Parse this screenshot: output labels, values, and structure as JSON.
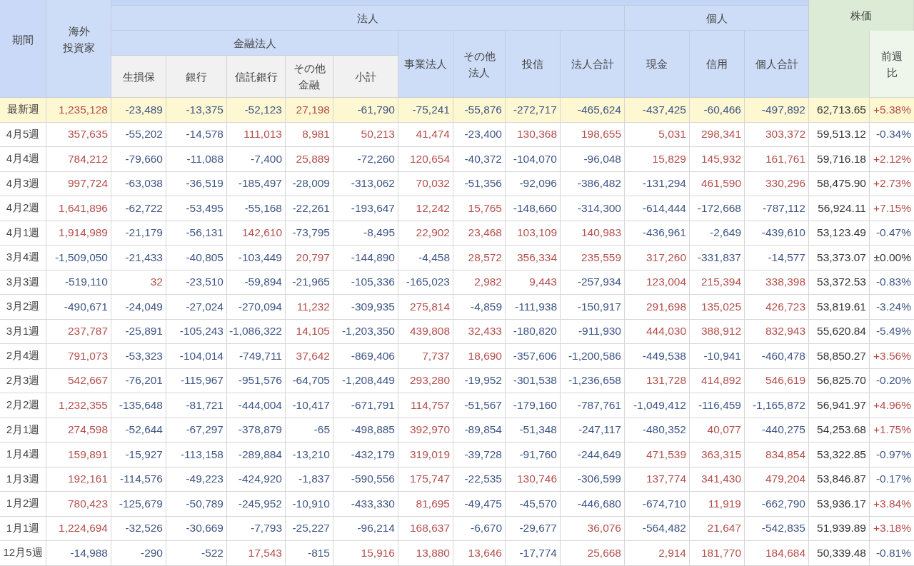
{
  "table": {
    "header": {
      "period": "期間",
      "foreign": "海外投資家",
      "corporate": "法人",
      "financial": "金融法人",
      "financial_columns": [
        "生損保",
        "銀行",
        "信託銀行",
        "その他金融",
        "小計"
      ],
      "corporate_columns": [
        "事業法人",
        "その他法人",
        "投信",
        "法人合計"
      ],
      "individual": "個人",
      "individual_columns": [
        "現金",
        "信用",
        "個人合計"
      ],
      "nikkei": "株価",
      "change": "前週比"
    },
    "rows": [
      {
        "period": "最新週",
        "highlighted": true,
        "flows": [
          {
            "text": "1,235,128",
            "color": "#b4504c"
          },
          {
            "text": "-23,489",
            "color": "#3f5786"
          },
          {
            "text": "-13,375",
            "color": "#3f5786"
          },
          {
            "text": "-52,123",
            "color": "#3f5786"
          },
          {
            "text": "27,198",
            "color": "#b4504c"
          },
          {
            "text": "-61,790",
            "color": "#3f5786"
          },
          {
            "text": "-75,241",
            "color": "#3f5786"
          },
          {
            "text": "-55,876",
            "color": "#3f5786"
          },
          {
            "text": "-272,717",
            "color": "#3f5786"
          },
          {
            "text": "-465,624",
            "color": "#3f5786"
          },
          {
            "text": "-437,425",
            "color": "#3f5786"
          },
          {
            "text": "-60,466",
            "color": "#3f5786"
          },
          {
            "text": "-497,892",
            "color": "#3f5786"
          }
        ],
        "nikkei": "62,713.65",
        "change": {
          "text": "+5.38%",
          "color": "#b4504c"
        }
      },
      {
        "period": "4月5週",
        "highlighted": false,
        "flows": [
          {
            "text": "357,635",
            "color": "#b4504c"
          },
          {
            "text": "-55,202",
            "color": "#3f5786"
          },
          {
            "text": "-14,578",
            "color": "#3f5786"
          },
          {
            "text": "111,013",
            "color": "#b4504c"
          },
          {
            "text": "8,981",
            "color": "#b4504c"
          },
          {
            "text": "50,213",
            "color": "#b4504c"
          },
          {
            "text": "41,474",
            "color": "#b4504c"
          },
          {
            "text": "-23,400",
            "color": "#3f5786"
          },
          {
            "text": "130,368",
            "color": "#b4504c"
          },
          {
            "text": "198,655",
            "color": "#b4504c"
          },
          {
            "text": "5,031",
            "color": "#b4504c"
          },
          {
            "text": "298,341",
            "color": "#b4504c"
          },
          {
            "text": "303,372",
            "color": "#b4504c"
          }
        ],
        "nikkei": "59,513.12",
        "change": {
          "text": "-0.34%",
          "color": "#3f5786"
        }
      },
      {
        "period": "4月4週",
        "highlighted": false,
        "flows": [
          {
            "text": "784,212",
            "color": "#b4504c"
          },
          {
            "text": "-79,660",
            "color": "#3f5786"
          },
          {
            "text": "-11,088",
            "color": "#3f5786"
          },
          {
            "text": "-7,400",
            "color": "#3f5786"
          },
          {
            "text": "25,889",
            "color": "#b4504c"
          },
          {
            "text": "-72,260",
            "color": "#3f5786"
          },
          {
            "text": "120,654",
            "color": "#b4504c"
          },
          {
            "text": "-40,372",
            "color": "#3f5786"
          },
          {
            "text": "-104,070",
            "color": "#3f5786"
          },
          {
            "text": "-96,048",
            "color": "#3f5786"
          },
          {
            "text": "15,829",
            "color": "#b4504c"
          },
          {
            "text": "145,932",
            "color": "#b4504c"
          },
          {
            "text": "161,761",
            "color": "#b4504c"
          }
        ],
        "nikkei": "59,716.18",
        "change": {
          "text": "+2.12%",
          "color": "#b4504c"
        }
      },
      {
        "period": "4月3週",
        "highlighted": false,
        "flows": [
          {
            "text": "997,724",
            "color": "#b4504c"
          },
          {
            "text": "-63,038",
            "color": "#3f5786"
          },
          {
            "text": "-36,519",
            "color": "#3f5786"
          },
          {
            "text": "-185,497",
            "color": "#3f5786"
          },
          {
            "text": "-28,009",
            "color": "#3f5786"
          },
          {
            "text": "-313,062",
            "color": "#3f5786"
          },
          {
            "text": "70,032",
            "color": "#b4504c"
          },
          {
            "text": "-51,356",
            "color": "#3f5786"
          },
          {
            "text": "-92,096",
            "color": "#3f5786"
          },
          {
            "text": "-386,482",
            "color": "#3f5786"
          },
          {
            "text": "-131,294",
            "color": "#3f5786"
          },
          {
            "text": "461,590",
            "color": "#b4504c"
          },
          {
            "text": "330,296",
            "color": "#b4504c"
          }
        ],
        "nikkei": "58,475.90",
        "change": {
          "text": "+2.73%",
          "color": "#b4504c"
        }
      },
      {
        "period": "4月2週",
        "highlighted": false,
        "flows": [
          {
            "text": "1,641,896",
            "color": "#b4504c"
          },
          {
            "text": "-62,722",
            "color": "#3f5786"
          },
          {
            "text": "-53,495",
            "color": "#3f5786"
          },
          {
            "text": "-55,168",
            "color": "#3f5786"
          },
          {
            "text": "-22,261",
            "color": "#3f5786"
          },
          {
            "text": "-193,647",
            "color": "#3f5786"
          },
          {
            "text": "12,242",
            "color": "#b4504c"
          },
          {
            "text": "15,765",
            "color": "#b4504c"
          },
          {
            "text": "-148,660",
            "color": "#3f5786"
          },
          {
            "text": "-314,300",
            "color": "#3f5786"
          },
          {
            "text": "-614,444",
            "color": "#3f5786"
          },
          {
            "text": "-172,668",
            "color": "#3f5786"
          },
          {
            "text": "-787,112",
            "color": "#3f5786"
          }
        ],
        "nikkei": "56,924.11",
        "change": {
          "text": "+7.15%",
          "color": "#b4504c"
        }
      },
      {
        "period": "4月1週",
        "highlighted": false,
        "flows": [
          {
            "text": "1,914,989",
            "color": "#b4504c"
          },
          {
            "text": "-21,179",
            "color": "#3f5786"
          },
          {
            "text": "-56,131",
            "color": "#3f5786"
          },
          {
            "text": "142,610",
            "color": "#b4504c"
          },
          {
            "text": "-73,795",
            "color": "#3f5786"
          },
          {
            "text": "-8,495",
            "color": "#3f5786"
          },
          {
            "text": "22,902",
            "color": "#b4504c"
          },
          {
            "text": "23,468",
            "color": "#b4504c"
          },
          {
            "text": "103,109",
            "color": "#b4504c"
          },
          {
            "text": "140,983",
            "color": "#b4504c"
          },
          {
            "text": "-436,961",
            "color": "#3f5786"
          },
          {
            "text": "-2,649",
            "color": "#3f5786"
          },
          {
            "text": "-439,610",
            "color": "#3f5786"
          }
        ],
        "nikkei": "53,123.49",
        "change": {
          "text": "-0.47%",
          "color": "#3f5786"
        }
      },
      {
        "period": "3月4週",
        "highlighted": false,
        "flows": [
          {
            "text": "-1,509,050",
            "color": "#3f5786"
          },
          {
            "text": "-21,433",
            "color": "#3f5786"
          },
          {
            "text": "-40,805",
            "color": "#3f5786"
          },
          {
            "text": "-103,449",
            "color": "#3f5786"
          },
          {
            "text": "20,797",
            "color": "#b4504c"
          },
          {
            "text": "-144,890",
            "color": "#3f5786"
          },
          {
            "text": "-4,458",
            "color": "#3f5786"
          },
          {
            "text": "28,572",
            "color": "#b4504c"
          },
          {
            "text": "356,334",
            "color": "#b4504c"
          },
          {
            "text": "235,559",
            "color": "#b4504c"
          },
          {
            "text": "317,260",
            "color": "#b4504c"
          },
          {
            "text": "-331,837",
            "color": "#3f5786"
          },
          {
            "text": "-14,577",
            "color": "#3f5786"
          }
        ],
        "nikkei": "53,373.07",
        "change": {
          "text": "±0.00%",
          "color": "#333333"
        }
      },
      {
        "period": "3月3週",
        "highlighted": false,
        "flows": [
          {
            "text": "-519,110",
            "color": "#3f5786"
          },
          {
            "text": "32",
            "color": "#b4504c"
          },
          {
            "text": "-23,510",
            "color": "#3f5786"
          },
          {
            "text": "-59,894",
            "color": "#3f5786"
          },
          {
            "text": "-21,965",
            "color": "#3f5786"
          },
          {
            "text": "-105,336",
            "color": "#3f5786"
          },
          {
            "text": "-165,023",
            "color": "#3f5786"
          },
          {
            "text": "2,982",
            "color": "#b4504c"
          },
          {
            "text": "9,443",
            "color": "#b4504c"
          },
          {
            "text": "-257,934",
            "color": "#3f5786"
          },
          {
            "text": "123,004",
            "color": "#b4504c"
          },
          {
            "text": "215,394",
            "color": "#b4504c"
          },
          {
            "text": "338,398",
            "color": "#b4504c"
          }
        ],
        "nikkei": "53,372.53",
        "change": {
          "text": "-0.83%",
          "color": "#3f5786"
        }
      },
      {
        "period": "3月2週",
        "highlighted": false,
        "flows": [
          {
            "text": "-490,671",
            "color": "#3f5786"
          },
          {
            "text": "-24,049",
            "color": "#3f5786"
          },
          {
            "text": "-27,024",
            "color": "#3f5786"
          },
          {
            "text": "-270,094",
            "color": "#3f5786"
          },
          {
            "text": "11,232",
            "color": "#b4504c"
          },
          {
            "text": "-309,935",
            "color": "#3f5786"
          },
          {
            "text": "275,814",
            "color": "#b4504c"
          },
          {
            "text": "-4,859",
            "color": "#3f5786"
          },
          {
            "text": "-111,938",
            "color": "#3f5786"
          },
          {
            "text": "-150,917",
            "color": "#3f5786"
          },
          {
            "text": "291,698",
            "color": "#b4504c"
          },
          {
            "text": "135,025",
            "color": "#b4504c"
          },
          {
            "text": "426,723",
            "color": "#b4504c"
          }
        ],
        "nikkei": "53,819.61",
        "change": {
          "text": "-3.24%",
          "color": "#3f5786"
        }
      },
      {
        "period": "3月1週",
        "highlighted": false,
        "flows": [
          {
            "text": "237,787",
            "color": "#b4504c"
          },
          {
            "text": "-25,891",
            "color": "#3f5786"
          },
          {
            "text": "-105,243",
            "color": "#3f5786"
          },
          {
            "text": "-1,086,322",
            "color": "#3f5786"
          },
          {
            "text": "14,105",
            "color": "#b4504c"
          },
          {
            "text": "-1,203,350",
            "color": "#3f5786"
          },
          {
            "text": "439,808",
            "color": "#b4504c"
          },
          {
            "text": "32,433",
            "color": "#b4504c"
          },
          {
            "text": "-180,820",
            "color": "#3f5786"
          },
          {
            "text": "-911,930",
            "color": "#3f5786"
          },
          {
            "text": "444,030",
            "color": "#b4504c"
          },
          {
            "text": "388,912",
            "color": "#b4504c"
          },
          {
            "text": "832,943",
            "color": "#b4504c"
          }
        ],
        "nikkei": "55,620.84",
        "change": {
          "text": "-5.49%",
          "color": "#3f5786"
        }
      },
      {
        "period": "2月4週",
        "highlighted": false,
        "flows": [
          {
            "text": "791,073",
            "color": "#b4504c"
          },
          {
            "text": "-53,323",
            "color": "#3f5786"
          },
          {
            "text": "-104,014",
            "color": "#3f5786"
          },
          {
            "text": "-749,711",
            "color": "#3f5786"
          },
          {
            "text": "37,642",
            "color": "#b4504c"
          },
          {
            "text": "-869,406",
            "color": "#3f5786"
          },
          {
            "text": "7,737",
            "color": "#b4504c"
          },
          {
            "text": "18,690",
            "color": "#b4504c"
          },
          {
            "text": "-357,606",
            "color": "#3f5786"
          },
          {
            "text": "-1,200,586",
            "color": "#3f5786"
          },
          {
            "text": "-449,538",
            "color": "#3f5786"
          },
          {
            "text": "-10,941",
            "color": "#3f5786"
          },
          {
            "text": "-460,478",
            "color": "#3f5786"
          }
        ],
        "nikkei": "58,850.27",
        "change": {
          "text": "+3.56%",
          "color": "#b4504c"
        }
      },
      {
        "period": "2月3週",
        "highlighted": false,
        "flows": [
          {
            "text": "542,667",
            "color": "#b4504c"
          },
          {
            "text": "-76,201",
            "color": "#3f5786"
          },
          {
            "text": "-115,967",
            "color": "#3f5786"
          },
          {
            "text": "-951,576",
            "color": "#3f5786"
          },
          {
            "text": "-64,705",
            "color": "#3f5786"
          },
          {
            "text": "-1,208,449",
            "color": "#3f5786"
          },
          {
            "text": "293,280",
            "color": "#b4504c"
          },
          {
            "text": "-19,952",
            "color": "#3f5786"
          },
          {
            "text": "-301,538",
            "color": "#3f5786"
          },
          {
            "text": "-1,236,658",
            "color": "#3f5786"
          },
          {
            "text": "131,728",
            "color": "#b4504c"
          },
          {
            "text": "414,892",
            "color": "#b4504c"
          },
          {
            "text": "546,619",
            "color": "#b4504c"
          }
        ],
        "nikkei": "56,825.70",
        "change": {
          "text": "-0.20%",
          "color": "#3f5786"
        }
      },
      {
        "period": "2月2週",
        "highlighted": false,
        "flows": [
          {
            "text": "1,232,355",
            "color": "#b4504c"
          },
          {
            "text": "-135,648",
            "color": "#3f5786"
          },
          {
            "text": "-81,721",
            "color": "#3f5786"
          },
          {
            "text": "-444,004",
            "color": "#3f5786"
          },
          {
            "text": "-10,417",
            "color": "#3f5786"
          },
          {
            "text": "-671,791",
            "color": "#3f5786"
          },
          {
            "text": "114,757",
            "color": "#b4504c"
          },
          {
            "text": "-51,567",
            "color": "#3f5786"
          },
          {
            "text": "-179,160",
            "color": "#3f5786"
          },
          {
            "text": "-787,761",
            "color": "#3f5786"
          },
          {
            "text": "-1,049,412",
            "color": "#3f5786"
          },
          {
            "text": "-116,459",
            "color": "#3f5786"
          },
          {
            "text": "-1,165,872",
            "color": "#3f5786"
          }
        ],
        "nikkei": "56,941.97",
        "change": {
          "text": "+4.96%",
          "color": "#b4504c"
        }
      },
      {
        "period": "2月1週",
        "highlighted": false,
        "flows": [
          {
            "text": "274,598",
            "color": "#b4504c"
          },
          {
            "text": "-52,644",
            "color": "#3f5786"
          },
          {
            "text": "-67,297",
            "color": "#3f5786"
          },
          {
            "text": "-378,879",
            "color": "#3f5786"
          },
          {
            "text": "-65",
            "color": "#3f5786"
          },
          {
            "text": "-498,885",
            "color": "#3f5786"
          },
          {
            "text": "392,970",
            "color": "#b4504c"
          },
          {
            "text": "-89,854",
            "color": "#3f5786"
          },
          {
            "text": "-51,348",
            "color": "#3f5786"
          },
          {
            "text": "-247,117",
            "color": "#3f5786"
          },
          {
            "text": "-480,352",
            "color": "#3f5786"
          },
          {
            "text": "40,077",
            "color": "#b4504c"
          },
          {
            "text": "-440,275",
            "color": "#3f5786"
          }
        ],
        "nikkei": "54,253.68",
        "change": {
          "text": "+1.75%",
          "color": "#b4504c"
        }
      },
      {
        "period": "1月4週",
        "highlighted": false,
        "flows": [
          {
            "text": "159,891",
            "color": "#b4504c"
          },
          {
            "text": "-15,927",
            "color": "#3f5786"
          },
          {
            "text": "-113,158",
            "color": "#3f5786"
          },
          {
            "text": "-289,884",
            "color": "#3f5786"
          },
          {
            "text": "-13,210",
            "color": "#3f5786"
          },
          {
            "text": "-432,179",
            "color": "#3f5786"
          },
          {
            "text": "319,019",
            "color": "#b4504c"
          },
          {
            "text": "-39,728",
            "color": "#3f5786"
          },
          {
            "text": "-91,760",
            "color": "#3f5786"
          },
          {
            "text": "-244,649",
            "color": "#3f5786"
          },
          {
            "text": "471,539",
            "color": "#b4504c"
          },
          {
            "text": "363,315",
            "color": "#b4504c"
          },
          {
            "text": "834,854",
            "color": "#b4504c"
          }
        ],
        "nikkei": "53,322.85",
        "change": {
          "text": "-0.97%",
          "color": "#3f5786"
        }
      },
      {
        "period": "1月3週",
        "highlighted": false,
        "flows": [
          {
            "text": "192,161",
            "color": "#b4504c"
          },
          {
            "text": "-114,576",
            "color": "#3f5786"
          },
          {
            "text": "-49,223",
            "color": "#3f5786"
          },
          {
            "text": "-424,920",
            "color": "#3f5786"
          },
          {
            "text": "-1,837",
            "color": "#3f5786"
          },
          {
            "text": "-590,556",
            "color": "#3f5786"
          },
          {
            "text": "175,747",
            "color": "#b4504c"
          },
          {
            "text": "-22,535",
            "color": "#3f5786"
          },
          {
            "text": "130,746",
            "color": "#b4504c"
          },
          {
            "text": "-306,599",
            "color": "#3f5786"
          },
          {
            "text": "137,774",
            "color": "#b4504c"
          },
          {
            "text": "341,430",
            "color": "#b4504c"
          },
          {
            "text": "479,204",
            "color": "#b4504c"
          }
        ],
        "nikkei": "53,846.87",
        "change": {
          "text": "-0.17%",
          "color": "#3f5786"
        }
      },
      {
        "period": "1月2週",
        "highlighted": false,
        "flows": [
          {
            "text": "780,423",
            "color": "#b4504c"
          },
          {
            "text": "-125,679",
            "color": "#3f5786"
          },
          {
            "text": "-50,789",
            "color": "#3f5786"
          },
          {
            "text": "-245,952",
            "color": "#3f5786"
          },
          {
            "text": "-10,910",
            "color": "#3f5786"
          },
          {
            "text": "-433,330",
            "color": "#3f5786"
          },
          {
            "text": "81,695",
            "color": "#b4504c"
          },
          {
            "text": "-49,475",
            "color": "#3f5786"
          },
          {
            "text": "-45,570",
            "color": "#3f5786"
          },
          {
            "text": "-446,680",
            "color": "#3f5786"
          },
          {
            "text": "-674,710",
            "color": "#3f5786"
          },
          {
            "text": "11,919",
            "color": "#b4504c"
          },
          {
            "text": "-662,790",
            "color": "#3f5786"
          }
        ],
        "nikkei": "53,936.17",
        "change": {
          "text": "+3.84%",
          "color": "#b4504c"
        }
      },
      {
        "period": "1月1週",
        "highlighted": false,
        "flows": [
          {
            "text": "1,224,694",
            "color": "#b4504c"
          },
          {
            "text": "-32,526",
            "color": "#3f5786"
          },
          {
            "text": "-30,669",
            "color": "#3f5786"
          },
          {
            "text": "-7,793",
            "color": "#3f5786"
          },
          {
            "text": "-25,227",
            "color": "#3f5786"
          },
          {
            "text": "-96,214",
            "color": "#3f5786"
          },
          {
            "text": "168,637",
            "color": "#b4504c"
          },
          {
            "text": "-6,670",
            "color": "#3f5786"
          },
          {
            "text": "-29,677",
            "color": "#3f5786"
          },
          {
            "text": "36,076",
            "color": "#b4504c"
          },
          {
            "text": "-564,482",
            "color": "#3f5786"
          },
          {
            "text": "21,647",
            "color": "#b4504c"
          },
          {
            "text": "-542,835",
            "color": "#3f5786"
          }
        ],
        "nikkei": "51,939.89",
        "change": {
          "text": "+3.18%",
          "color": "#b4504c"
        }
      },
      {
        "period": "12月5週",
        "highlighted": false,
        "flows": [
          {
            "text": "-14,988",
            "color": "#3f5786"
          },
          {
            "text": "-290",
            "color": "#3f5786"
          },
          {
            "text": "-522",
            "color": "#3f5786"
          },
          {
            "text": "17,543",
            "color": "#b4504c"
          },
          {
            "text": "-815",
            "color": "#3f5786"
          },
          {
            "text": "15,916",
            "color": "#b4504c"
          },
          {
            "text": "13,880",
            "color": "#b4504c"
          },
          {
            "text": "13,646",
            "color": "#b4504c"
          },
          {
            "text": "-17,774",
            "color": "#3f5786"
          },
          {
            "text": "25,668",
            "color": "#b4504c"
          },
          {
            "text": "2,914",
            "color": "#b4504c"
          },
          {
            "text": "181,770",
            "color": "#b4504c"
          },
          {
            "text": "184,684",
            "color": "#b4504c"
          }
        ],
        "nikkei": "50,339.48",
        "change": {
          "text": "-0.81%",
          "color": "#3f5786"
        }
      }
    ]
  }
}
